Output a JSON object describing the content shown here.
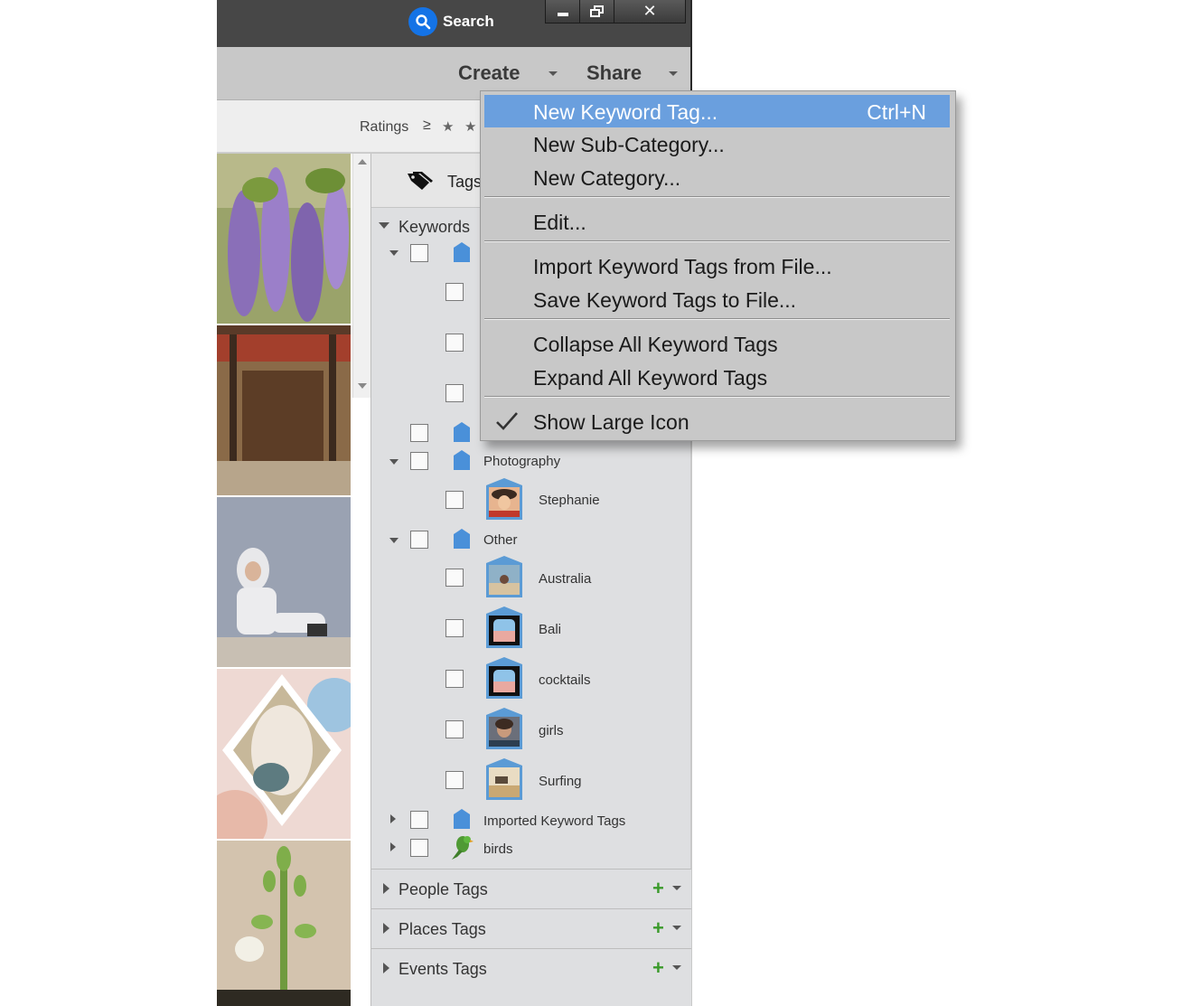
{
  "titlebar": {
    "search_label": "Search"
  },
  "menubar": {
    "create_label": "Create",
    "share_label": "Share"
  },
  "filter": {
    "ratings_label": "Ratings",
    "ratings_operator": "≥"
  },
  "tags_panel": {
    "header_label": "Tags",
    "keywords_label": "Keywords",
    "categories": {
      "photography": "Photography",
      "other": "Other",
      "imported": "Imported Keyword Tags",
      "birds": "birds"
    },
    "tags": {
      "stephanie": "Stephanie",
      "australia": "Australia",
      "bali": "Bali",
      "cocktails": "cocktails",
      "girls": "girls",
      "surfing": "Surfing"
    },
    "sections": [
      "People Tags",
      "Places Tags",
      "Events Tags"
    ]
  },
  "context_menu": {
    "items": [
      {
        "label": "New Keyword Tag...",
        "shortcut": "Ctrl+N",
        "highlighted": true
      },
      {
        "label": "New Sub-Category..."
      },
      {
        "label": "New Category..."
      },
      {
        "label": "Edit..."
      },
      {
        "label": "Import Keyword Tags from File..."
      },
      {
        "label": "Save Keyword Tags to File..."
      },
      {
        "label": "Collapse All Keyword Tags"
      },
      {
        "label": "Expand All Keyword Tags"
      },
      {
        "label": "Show Large Icon",
        "checked": true
      }
    ]
  },
  "colors": {
    "accent_blue": "#1473e6",
    "menu_highlight": "#6a9fde",
    "add_green": "#3a9a2a",
    "category_blue": "#4a90d9"
  }
}
